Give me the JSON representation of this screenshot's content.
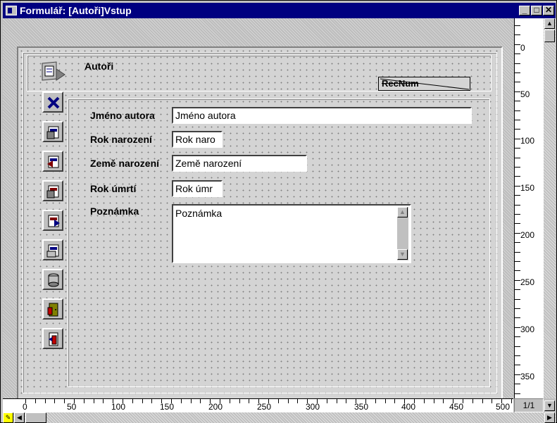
{
  "window": {
    "title": "Formulář: [Autoři]Vstup",
    "minimize": "_",
    "maximize": "□",
    "close": "✕"
  },
  "form": {
    "header_title": "Autoři",
    "recnum_label": "RecNum",
    "fields": [
      {
        "label": "Jméno autora",
        "value": "Jméno autora"
      },
      {
        "label": "Rok narození",
        "value": "Rok naro"
      },
      {
        "label": "Země narození",
        "value": "Země narození"
      },
      {
        "label": "Rok úmrtí",
        "value": "Rok úmr"
      },
      {
        "label": "Poznámka",
        "value": "Poznámka"
      }
    ],
    "nav_buttons": [
      "form-icon",
      "delete-icon",
      "first-record-icon",
      "previous-record-icon",
      "next-record-icon",
      "last-record-icon",
      "new-record-icon",
      "save-icon",
      "exit-icon",
      "close-form-icon"
    ]
  },
  "rulers": {
    "vertical": [
      "0",
      "50",
      "100",
      "150",
      "200",
      "250",
      "300",
      "350"
    ],
    "horizontal": [
      "0",
      "50",
      "100",
      "150",
      "200",
      "250",
      "300",
      "350",
      "400",
      "450",
      "500"
    ],
    "page_indicator": "1/1"
  },
  "colors": {
    "titlebar": "#000080",
    "face": "#c0c0c0",
    "field_bg": "#ffffff"
  }
}
